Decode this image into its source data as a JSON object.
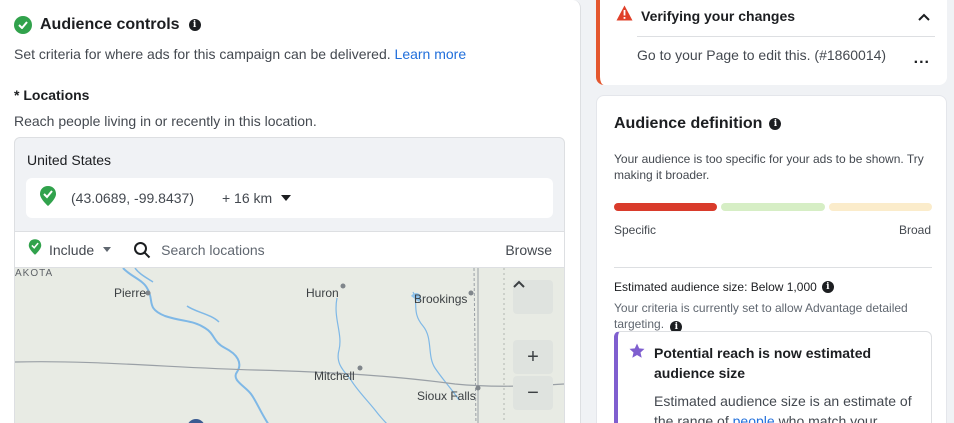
{
  "audience_controls": {
    "title": "Audience controls",
    "description": "Set criteria for where ads for this campaign can be delivered.",
    "learn_more": "Learn more",
    "locations_label": "* Locations",
    "locations_desc": "Reach people living in or recently in this location.",
    "country": "United States",
    "pin": {
      "coords": "(43.0689, -99.8437)",
      "radius": "+ 16 km"
    },
    "include_label": "Include",
    "search_placeholder": "Search locations",
    "browse_label": "Browse",
    "map_labels": {
      "state_fragment": "AKOTA",
      "pierre": "Pierre",
      "huron": "Huron",
      "brookings": "Brookings",
      "mitchell": "Mitchell",
      "sioux_falls": "Sioux Falls"
    },
    "map_controls": {
      "collapse": "^",
      "zoom_in": "+",
      "zoom_out": "−"
    }
  },
  "verify_panel": {
    "title": "Verifying your changes",
    "message": "Go to your Page to edit this. (#1860014)",
    "more_label": "...",
    "accent_color": "#e4572e"
  },
  "audience_definition": {
    "title": "Audience definition",
    "description": "Your audience is too specific for your ads to be shown. Try making it broader.",
    "meter_colors": [
      "#d93b2b",
      "#d6eec5",
      "#fbeccb"
    ],
    "specific_label": "Specific",
    "broad_label": "Broad",
    "estimated_size": "Estimated audience size: Below 1,000",
    "criteria_note": "Your criteria is currently set to allow Advantage detailed targeting.",
    "reach_title": "Potential reach is now estimated audience size",
    "reach_body_prefix": "Estimated audience size is an estimate of the range of",
    "reach_body_link": "people",
    "reach_body_suffix": "who match your"
  },
  "icons": [
    "check-circle-icon",
    "info-icon",
    "map-pin-icon",
    "search-icon",
    "warning-icon",
    "chevron-up-icon",
    "star-icon"
  ],
  "colors": {
    "brand_blue": "#216fdb",
    "success_green": "#31a24c",
    "purple_accent": "#7f5fcf"
  }
}
